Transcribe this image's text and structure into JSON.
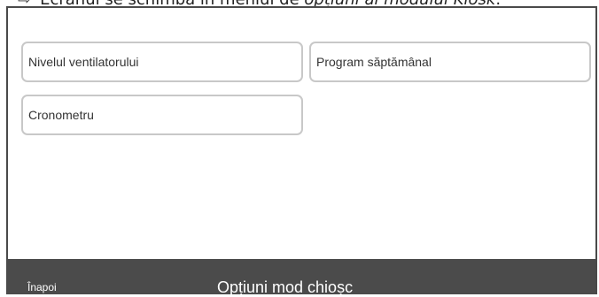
{
  "instruction": {
    "text_before": "Ecranul se schimbă în meniul de ",
    "text_emphasis": "opțiuni al modului Kiosk",
    "text_after": "."
  },
  "menu": {
    "options": [
      {
        "label": "Nivelul ventilatorului"
      },
      {
        "label": "Program săptămânal"
      },
      {
        "label": "Cronometru"
      }
    ]
  },
  "footer": {
    "back_label": "Înapoi",
    "title": "Opțiuni mod chioșc"
  },
  "colors": {
    "footer_bg": "#4b4b4b",
    "button_border": "#c8c8c8",
    "screen_border": "#4a4a4a"
  }
}
